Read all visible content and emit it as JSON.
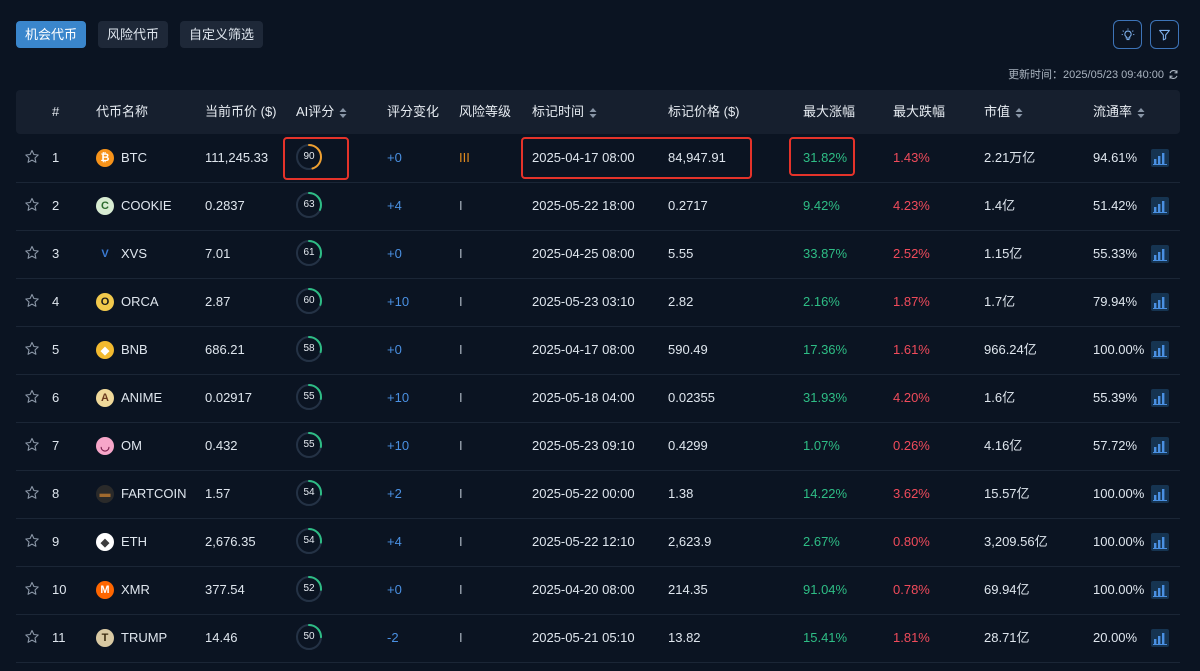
{
  "tabs": [
    {
      "label": "机会代币",
      "active": true
    },
    {
      "label": "风险代币",
      "active": false
    },
    {
      "label": "自定义筛选",
      "active": false
    }
  ],
  "toolbar": {
    "icons": [
      "bulb-icon",
      "filter-icon"
    ]
  },
  "updated_label": "更新时间：2025/05/23 09:40:00",
  "columns": {
    "index": "#",
    "name": "代币名称",
    "price": "当前币价 ($)",
    "ai_score": "AI评分",
    "score_change": "评分变化",
    "risk": "风险等级",
    "mark_time": "标记时间",
    "mark_price": "标记价格 ($)",
    "max_gain": "最大涨幅",
    "max_drop": "最大跌幅",
    "market_cap": "市值",
    "circulation": "流通率"
  },
  "rows": [
    {
      "index": "1",
      "symbol": "BTC",
      "icon": "btc-icon",
      "price": "111,245.33",
      "score": "90",
      "score_value": 90,
      "change": "+0",
      "risk": "III",
      "mark_time": "2025-04-17 08:00",
      "mark_price": "84,947.91",
      "gain": "31.82%",
      "drop": "1.43%",
      "cap": "2.21万亿",
      "circ": "94.61%"
    },
    {
      "index": "2",
      "symbol": "COOKIE",
      "icon": "cookie-icon",
      "price": "0.2837",
      "score": "63",
      "score_value": 63,
      "change": "+4",
      "risk": "I",
      "mark_time": "2025-05-22 18:00",
      "mark_price": "0.2717",
      "gain": "9.42%",
      "drop": "4.23%",
      "cap": "1.4亿",
      "circ": "51.42%"
    },
    {
      "index": "3",
      "symbol": "XVS",
      "icon": "xvs-icon",
      "price": "7.01",
      "score": "61",
      "score_value": 61,
      "change": "+0",
      "risk": "I",
      "mark_time": "2025-04-25 08:00",
      "mark_price": "5.55",
      "gain": "33.87%",
      "drop": "2.52%",
      "cap": "1.15亿",
      "circ": "55.33%"
    },
    {
      "index": "4",
      "symbol": "ORCA",
      "icon": "orca-icon",
      "price": "2.87",
      "score": "60",
      "score_value": 60,
      "change": "+10",
      "risk": "I",
      "mark_time": "2025-05-23 03:10",
      "mark_price": "2.82",
      "gain": "2.16%",
      "drop": "1.87%",
      "cap": "1.7亿",
      "circ": "79.94%"
    },
    {
      "index": "5",
      "symbol": "BNB",
      "icon": "bnb-icon",
      "price": "686.21",
      "score": "58",
      "score_value": 58,
      "change": "+0",
      "risk": "I",
      "mark_time": "2025-04-17 08:00",
      "mark_price": "590.49",
      "gain": "17.36%",
      "drop": "1.61%",
      "cap": "966.24亿",
      "circ": "100.00%"
    },
    {
      "index": "6",
      "symbol": "ANIME",
      "icon": "anime-icon",
      "price": "0.02917",
      "score": "55",
      "score_value": 55,
      "change": "+10",
      "risk": "I",
      "mark_time": "2025-05-18 04:00",
      "mark_price": "0.02355",
      "gain": "31.93%",
      "drop": "4.20%",
      "cap": "1.6亿",
      "circ": "55.39%"
    },
    {
      "index": "7",
      "symbol": "OM",
      "icon": "om-icon",
      "price": "0.432",
      "score": "55",
      "score_value": 55,
      "change": "+10",
      "risk": "I",
      "mark_time": "2025-05-23 09:10",
      "mark_price": "0.4299",
      "gain": "1.07%",
      "drop": "0.26%",
      "cap": "4.16亿",
      "circ": "57.72%"
    },
    {
      "index": "8",
      "symbol": "FARTCOIN",
      "icon": "fartcoin-icon",
      "price": "1.57",
      "score": "54",
      "score_value": 54,
      "change": "+2",
      "risk": "I",
      "mark_time": "2025-05-22 00:00",
      "mark_price": "1.38",
      "gain": "14.22%",
      "drop": "3.62%",
      "cap": "15.57亿",
      "circ": "100.00%"
    },
    {
      "index": "9",
      "symbol": "ETH",
      "icon": "eth-icon",
      "price": "2,676.35",
      "score": "54",
      "score_value": 54,
      "change": "+4",
      "risk": "I",
      "mark_time": "2025-05-22 12:10",
      "mark_price": "2,623.9",
      "gain": "2.67%",
      "drop": "0.80%",
      "cap": "3,209.56亿",
      "circ": "100.00%"
    },
    {
      "index": "10",
      "symbol": "XMR",
      "icon": "xmr-icon",
      "price": "377.54",
      "score": "52",
      "score_value": 52,
      "change": "+0",
      "risk": "I",
      "mark_time": "2025-04-20 08:00",
      "mark_price": "214.35",
      "gain": "91.04%",
      "drop": "0.78%",
      "cap": "69.94亿",
      "circ": "100.00%"
    },
    {
      "index": "11",
      "symbol": "TRUMP",
      "icon": "trump-icon",
      "price": "14.46",
      "score": "50",
      "score_value": 50,
      "change": "-2",
      "risk": "I",
      "mark_time": "2025-05-21 05:10",
      "mark_price": "13.82",
      "gain": "15.41%",
      "drop": "1.81%",
      "cap": "28.71亿",
      "circ": "20.00%"
    }
  ],
  "colors": {
    "background": "#0b1422",
    "header": "#161f2e",
    "accent": "#3a86cc",
    "gain": "#2ebd85",
    "drop": "#f04b5b",
    "score_high": "#f0a030",
    "score_mid": "#2ebd85",
    "highlight": "#e5332a"
  }
}
